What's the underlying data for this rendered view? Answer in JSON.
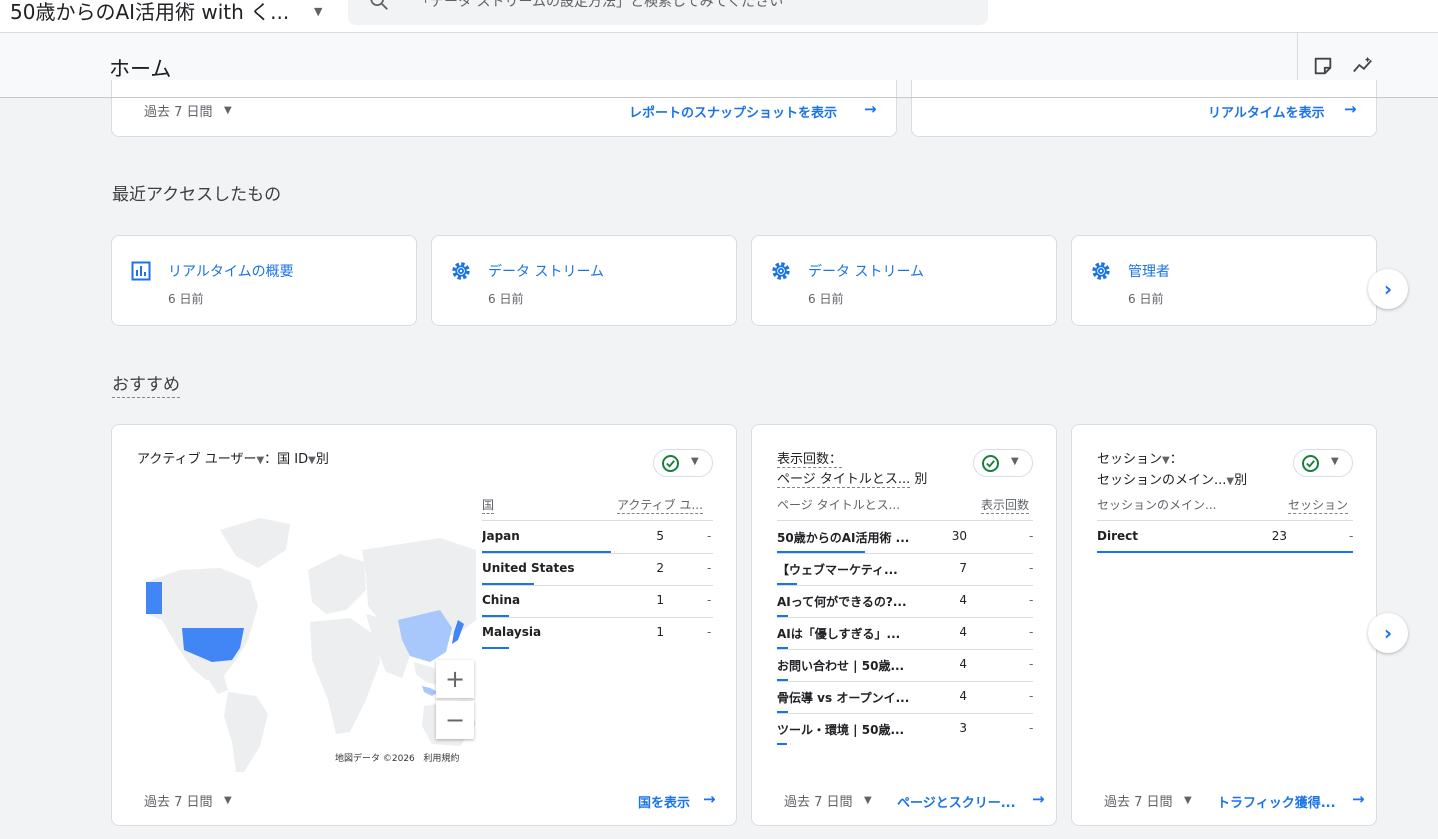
{
  "topbar": {
    "property_title": "50歳からのAI活用術 with く...",
    "search_placeholder": "「データ ストリームの設定方法」と検索してみてください"
  },
  "header": {
    "title": "ホーム"
  },
  "top_cards": {
    "left_range": "過去 7 日間",
    "left_link": "レポートのスナップショットを表示",
    "right_link": "リアルタイムを表示"
  },
  "recent": {
    "title": "最近アクセスしたもの",
    "items": [
      {
        "label": "リアルタイムの概要",
        "time": "6 日前",
        "icon": "bar-chart-icon"
      },
      {
        "label": "データ ストリーム",
        "time": "6 日前",
        "icon": "gear-icon"
      },
      {
        "label": "データ ストリーム",
        "time": "6 日前",
        "icon": "gear-icon"
      },
      {
        "label": "管理者",
        "time": "6 日前",
        "icon": "gear-icon"
      }
    ]
  },
  "recommended": {
    "title": "おすすめ",
    "country_card": {
      "title_metric": "アクティブ ユーザー",
      "title_sep": "：",
      "title_dim": "国 ID",
      "title_suffix": "別",
      "col_country": "国",
      "col_metric": "アクティブ ユ...",
      "rows": [
        {
          "label": "Japan",
          "value": "5",
          "delta": "-",
          "share": 1.0
        },
        {
          "label": "United States",
          "value": "2",
          "delta": "-",
          "share": 0.4
        },
        {
          "label": "China",
          "value": "1",
          "delta": "-",
          "share": 0.2
        },
        {
          "label": "Malaysia",
          "value": "1",
          "delta": "-",
          "share": 0.2
        }
      ],
      "zoom_in": "+",
      "zoom_out": "−",
      "map_attribution": "地図データ ©2026",
      "map_terms": "利用規約",
      "range": "過去 7 日間",
      "link": "国を表示"
    },
    "views_card": {
      "title_line1": "表示回数：",
      "title_line2": "ページ タイトルとス...",
      "title_suffix": "別",
      "col_dim": "ページ タイトルとス...",
      "col_metric": "表示回数",
      "rows": [
        {
          "label": "50歳からのAI活用術 ...",
          "value": "30",
          "delta": "-",
          "share": 1.0
        },
        {
          "label": "【ウェブマーケティ...",
          "value": "7",
          "delta": "-",
          "share": 0.23
        },
        {
          "label": "AIって何ができるの?...",
          "value": "4",
          "delta": "-",
          "share": 0.13
        },
        {
          "label": "AIは「優しすぎる」...",
          "value": "4",
          "delta": "-",
          "share": 0.13
        },
        {
          "label": "お問い合わせ | 50歳...",
          "value": "4",
          "delta": "-",
          "share": 0.13
        },
        {
          "label": "骨伝導 vs オープンイ...",
          "value": "4",
          "delta": "-",
          "share": 0.13
        },
        {
          "label": "ツール・環境 | 50歳...",
          "value": "3",
          "delta": "-",
          "share": 0.1
        }
      ],
      "range": "過去 7 日間",
      "link": "ページとスクリー..."
    },
    "sessions_card": {
      "title_line1": "セッション",
      "title_line1_suffix": "：",
      "title_line2": "セッションのメイン...",
      "title_suffix": "別",
      "col_dim": "セッションのメイン...",
      "col_metric": "セッション",
      "rows": [
        {
          "label": "Direct",
          "value": "23",
          "delta": "-",
          "share": 1.0
        }
      ],
      "range": "過去 7 日間",
      "link": "トラフィック獲得..."
    }
  },
  "colors": {
    "accent": "#1a73e8",
    "map_highlight_strong": "#4285f4",
    "map_highlight_light": "#a8c7fa",
    "map_land": "#eceeef"
  }
}
